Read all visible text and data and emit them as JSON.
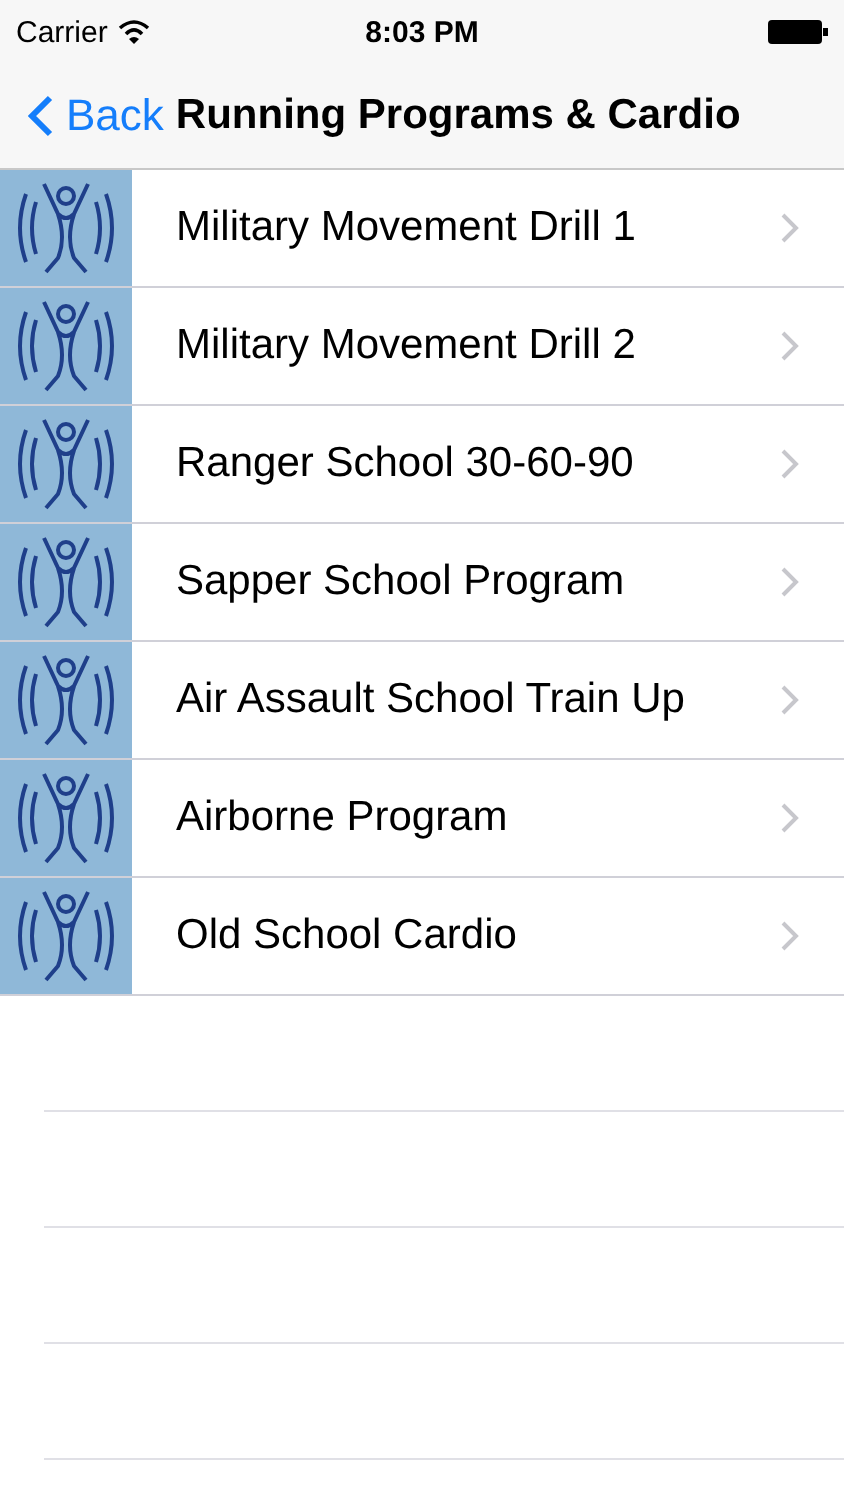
{
  "status_bar": {
    "carrier": "Carrier",
    "time": "8:03 PM"
  },
  "nav_bar": {
    "back": "Back",
    "title": "Running Programs & Cardio"
  },
  "rows": [
    {
      "title": "Military Movement Drill 1"
    },
    {
      "title": "Military Movement Drill 2"
    },
    {
      "title": "Ranger School 30-60-90"
    },
    {
      "title": "Sapper School Program"
    },
    {
      "title": "Air Assault School Train Up"
    },
    {
      "title": "Airborne Program"
    },
    {
      "title": "Old School Cardio"
    }
  ]
}
